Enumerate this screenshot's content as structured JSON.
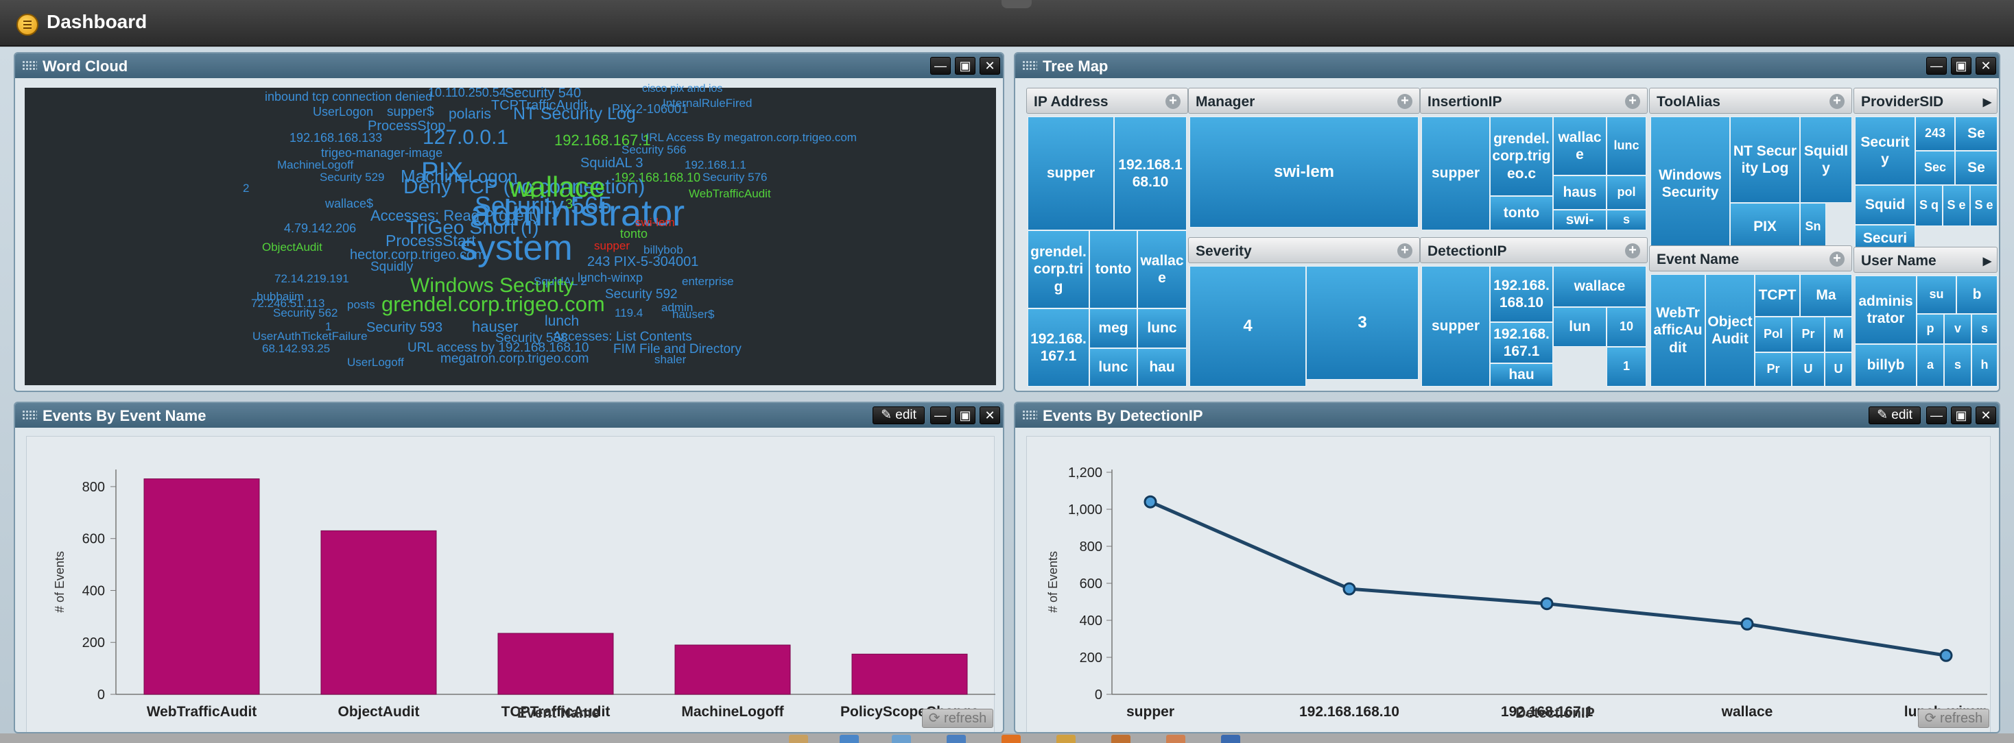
{
  "app": {
    "title": "Dashboard"
  },
  "colors": {
    "bar": "#b00b6e",
    "line": "#1f4566",
    "point": "#4a9bd6",
    "treemap_cell": "#2b8fcc"
  },
  "panels": {
    "word_cloud": {
      "title": "Word Cloud"
    },
    "tree_map": {
      "title": "Tree Map"
    },
    "events_by_name": {
      "title": "Events By Event Name",
      "edit_label": "edit",
      "refresh_label": "refresh"
    },
    "events_by_ip": {
      "title": "Events By DetectionIP",
      "edit_label": "edit",
      "refresh_label": "refresh"
    }
  },
  "window_buttons": {
    "minimize": "—",
    "maximize": "▣",
    "close": "✕"
  },
  "word_cloud": {
    "words": [
      {
        "t": "inbound tcp connection denied",
        "c": "#3b8fd8"
      },
      {
        "t": "10.110.250.54",
        "c": "#3b8fd8"
      },
      {
        "t": "Security 540",
        "c": "#3b8fd8"
      },
      {
        "t": "cisco pix and ios",
        "c": "#3b8fd8"
      },
      {
        "t": "InternalRuleFired",
        "c": "#3b8fd8"
      },
      {
        "t": "TCPTrafficAudit",
        "c": "#3b8fd8"
      },
      {
        "t": "PIX-2-106001",
        "c": "#3b8fd8"
      },
      {
        "t": "UserLogon",
        "c": "#3b8fd8"
      },
      {
        "t": "supper$",
        "c": "#3b8fd8"
      },
      {
        "t": "polaris",
        "c": "#3b8fd8"
      },
      {
        "t": "NT Security Log",
        "c": "#3b8fd8"
      },
      {
        "t": "ProcessStop",
        "c": "#3b8fd8"
      },
      {
        "t": "URL Access By megatron.corp.trigeo.com",
        "c": "#3b8fd8"
      },
      {
        "t": "192.168.168.133",
        "c": "#3b8fd8"
      },
      {
        "t": "127.0.0.1",
        "c": "#3b8fd8"
      },
      {
        "t": "192.168.167.1",
        "c": "#53d23a"
      },
      {
        "t": "Security 566",
        "c": "#3b8fd8"
      },
      {
        "t": "trigeo-manager-image",
        "c": "#3b8fd8"
      },
      {
        "t": "SquidAL 3",
        "c": "#3b8fd8"
      },
      {
        "t": "MachineLogoff",
        "c": "#3b8fd8"
      },
      {
        "t": "192.168.1.1",
        "c": "#3b8fd8"
      },
      {
        "t": "Security 529",
        "c": "#3b8fd8"
      },
      {
        "t": "MachineLogon",
        "c": "#3b8fd8"
      },
      {
        "t": "PIX",
        "c": "#3b8fd8"
      },
      {
        "t": "192.168.168.10",
        "c": "#53d23a"
      },
      {
        "t": "Security 576",
        "c": "#3b8fd8"
      },
      {
        "t": "2",
        "c": "#3b8fd8"
      },
      {
        "t": "Deny TCP (no connection)",
        "c": "#3b8fd8"
      },
      {
        "t": "wallace",
        "c": "#53d23a"
      },
      {
        "t": "4",
        "c": "#53d23a"
      },
      {
        "t": "WebTrafficAudit",
        "c": "#53d23a"
      },
      {
        "t": "wallace$",
        "c": "#3b8fd8"
      },
      {
        "t": "Security 565",
        "c": "#3b8fd8"
      },
      {
        "t": "3",
        "c": "#53d23a"
      },
      {
        "t": "Accesses: Read Property",
        "c": "#3b8fd8"
      },
      {
        "t": "administrator",
        "c": "#3b8fd8"
      },
      {
        "t": "swi-lem",
        "c": "#e8281d"
      },
      {
        "t": "4.79.142.206",
        "c": "#3b8fd8"
      },
      {
        "t": "TriGeo Snort (I)",
        "c": "#3b8fd8"
      },
      {
        "t": "tonto",
        "c": "#53d23a"
      },
      {
        "t": "ProcessStart",
        "c": "#3b8fd8"
      },
      {
        "t": "ObjectAudit",
        "c": "#53d23a"
      },
      {
        "t": "system",
        "c": "#3b8fd8"
      },
      {
        "t": "supper",
        "c": "#e8281d"
      },
      {
        "t": "billybob",
        "c": "#3b8fd8"
      },
      {
        "t": "hector.corp.trigeo.com",
        "c": "#3b8fd8"
      },
      {
        "t": "243 PIX-5-304001",
        "c": "#3b8fd8"
      },
      {
        "t": "Squidly",
        "c": "#3b8fd8"
      },
      {
        "t": "lunch-winxp",
        "c": "#3b8fd8"
      },
      {
        "t": "72.14.219.191",
        "c": "#3b8fd8"
      },
      {
        "t": "SquidAL 2",
        "c": "#3b8fd8"
      },
      {
        "t": "enterprise",
        "c": "#3b8fd8"
      },
      {
        "t": "Windows Security",
        "c": "#53d23a"
      },
      {
        "t": "bubbajim",
        "c": "#3b8fd8"
      },
      {
        "t": "Security 592",
        "c": "#3b8fd8"
      },
      {
        "t": "72.246.51.113",
        "c": "#3b8fd8"
      },
      {
        "t": "posts",
        "c": "#3b8fd8"
      },
      {
        "t": "grendel.corp.trigeo.com",
        "c": "#53d23a"
      },
      {
        "t": "admin",
        "c": "#3b8fd8"
      },
      {
        "t": "Security 562",
        "c": "#3b8fd8"
      },
      {
        "t": "119.4",
        "c": "#3b8fd8"
      },
      {
        "t": "hauser$",
        "c": "#3b8fd8"
      },
      {
        "t": "1",
        "c": "#3b8fd8"
      },
      {
        "t": "lunch",
        "c": "#3b8fd8"
      },
      {
        "t": "Security 593",
        "c": "#3b8fd8"
      },
      {
        "t": "hauser",
        "c": "#3b8fd8"
      },
      {
        "t": "UserAuthTicketFailure",
        "c": "#3b8fd8"
      },
      {
        "t": "Security 538",
        "c": "#3b8fd8"
      },
      {
        "t": "Accesses: List Contents",
        "c": "#3b8fd8"
      },
      {
        "t": "68.142.93.25",
        "c": "#3b8fd8"
      },
      {
        "t": "URL access by 192.168.168.10",
        "c": "#3b8fd8"
      },
      {
        "t": "FIM File and Directory",
        "c": "#3b8fd8"
      },
      {
        "t": "megatron.corp.trigeo.com",
        "c": "#3b8fd8"
      },
      {
        "t": "shaler",
        "c": "#3b8fd8"
      },
      {
        "t": "UserLogoff",
        "c": "#3b8fd8"
      }
    ]
  },
  "tree_map": {
    "columns": [
      {
        "header": "IP Address",
        "cells": [
          "supper",
          "192.168.168.10",
          "grendel.corp.trig",
          "tonto",
          "wallace",
          "192.168.167.1",
          "meg",
          "lunc",
          "lunc",
          "hau"
        ]
      },
      {
        "header": "Manager",
        "cells": [
          "swi-lem"
        ]
      },
      {
        "header": "Severity",
        "cells": [
          "4",
          "3"
        ]
      },
      {
        "header": "InsertionIP",
        "cells": [
          "supper",
          "grendel.corp.trigeo.c",
          "wallace",
          "lunc",
          "tonto",
          "haus",
          "pol",
          "swi-",
          "s"
        ]
      },
      {
        "header": "DetectionIP",
        "cells": [
          "supper",
          "192.168.168.10",
          "wallace",
          "lun",
          "10",
          "192.168.167.1",
          "hau",
          "1"
        ]
      },
      {
        "header": "ToolAlias",
        "cells": [
          "Windows Security",
          "NT Security Log",
          "Squidly",
          "PIX",
          "Sn"
        ]
      },
      {
        "header": "Event Name",
        "cells": [
          "WebTrafficAudit",
          "ObjectAudit",
          "TCPT",
          "Ma",
          "Pol",
          "Pr",
          "M",
          "Pr",
          "U",
          "U"
        ]
      },
      {
        "header": "ProviderSID",
        "cells": [
          "Security",
          "243",
          "Se",
          "Squid",
          "Sec",
          "Se",
          "Securi",
          "S q",
          "S e",
          "S e"
        ]
      },
      {
        "header": "User Name",
        "cells": [
          "administrator",
          "su",
          "b",
          "p",
          "v",
          "s",
          "billyb",
          "a",
          "s",
          "h"
        ]
      }
    ]
  },
  "chart_data": [
    {
      "type": "bar",
      "categories": [
        "WebTrafficAudit",
        "ObjectAudit",
        "TCPTrafficAudit",
        "MachineLogoff",
        "PolicyScopeChange"
      ],
      "values": [
        830,
        630,
        235,
        190,
        155
      ],
      "xlabel": "Event Name",
      "ylabel": "# of Events",
      "ylim": [
        0,
        850
      ],
      "yticks": [
        0,
        200,
        400,
        600,
        800
      ],
      "grid": false
    },
    {
      "type": "line",
      "categories": [
        "supper",
        "192.168.168.10",
        "192.168.167.1",
        "wallace",
        "lunch-winxp"
      ],
      "values": [
        1040,
        570,
        490,
        380,
        210
      ],
      "xlabel": "DetectionIP",
      "ylabel": "# of Events",
      "ylim": [
        0,
        1200
      ],
      "yticks": [
        0,
        200,
        400,
        600,
        800,
        "1,000",
        "1,200"
      ],
      "grid": false
    }
  ]
}
